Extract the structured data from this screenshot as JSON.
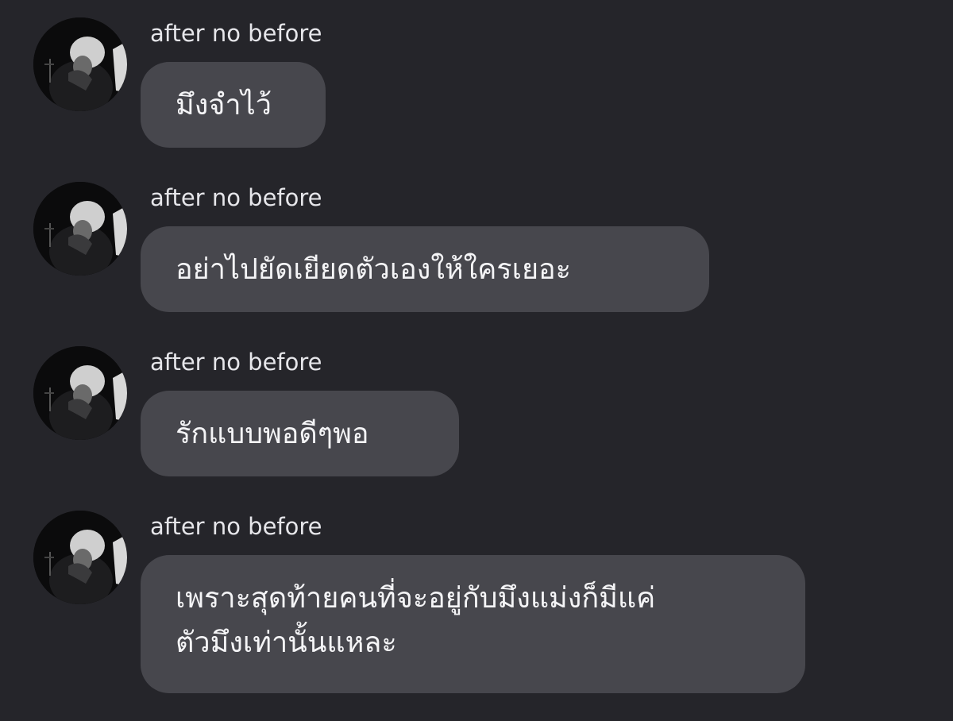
{
  "messages": [
    {
      "sender": "after no before",
      "text": "มึงจำไว้",
      "avatar_icon": "profile-photo-icon"
    },
    {
      "sender": "after no before",
      "text": "อย่าไปยัดเยียดตัวเองให้ใครเยอะ",
      "avatar_icon": "profile-photo-icon"
    },
    {
      "sender": "after no before",
      "text": "รักแบบพอดีๆพอ",
      "avatar_icon": "profile-photo-icon"
    },
    {
      "sender": "after no before",
      "text": "เพราะสุดท้ายคนที่จะอยู่กับมึงแม่งก็มีแค่\nตัวมึงเท่านั้นแหละ",
      "avatar_icon": "profile-photo-icon"
    }
  ],
  "colors": {
    "background": "#25252a",
    "bubble": "#47474d",
    "text": "#f4f4f6",
    "sender": "#e6e6ea"
  }
}
